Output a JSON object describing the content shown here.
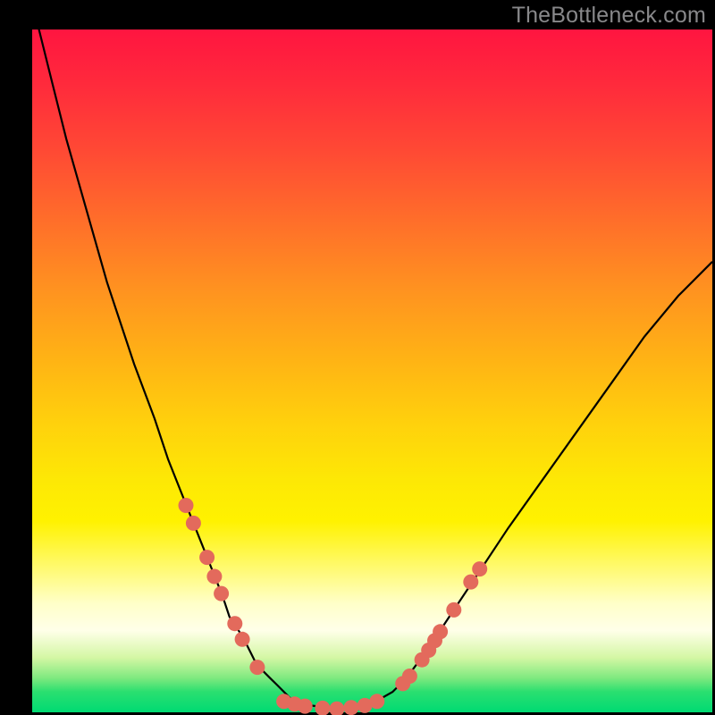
{
  "watermark": "TheBottleneck.com",
  "colors": {
    "frame": "#000000",
    "curve": "#000000",
    "dot": "#e36a5c",
    "gradient_top": "#ff1540",
    "gradient_bottom": "#00da73"
  },
  "chart_data": {
    "type": "line",
    "title": "",
    "xlabel": "",
    "ylabel": "",
    "xlim": [
      0,
      100
    ],
    "ylim": [
      0,
      100
    ],
    "note": "Axes are unlabeled in the source image; x is an arbitrary parameter (0–100) and y reads as percentage-like bottleneck magnitude (0–100). Values estimated from pixel positions.",
    "series": [
      {
        "name": "curve",
        "x": [
          0,
          1,
          3,
          5,
          7,
          9,
          11,
          13,
          15,
          18,
          20,
          22,
          24,
          26,
          28,
          29,
          31,
          32,
          33,
          35,
          36,
          38,
          41,
          44,
          47,
          50,
          53,
          55,
          58,
          62,
          66,
          70,
          75,
          80,
          85,
          90,
          95,
          100
        ],
        "y": [
          104,
          100,
          92,
          84,
          77,
          70,
          63,
          57,
          51,
          43,
          37,
          32,
          27,
          22,
          17,
          14,
          11,
          9,
          7,
          5,
          4,
          2,
          1,
          0.6,
          0.6,
          1.3,
          3,
          5,
          9,
          15,
          21,
          27,
          34,
          41,
          48,
          55,
          61,
          66
        ]
      }
    ],
    "markers": {
      "name": "dots",
      "note": "Salmon colored dots placed on the curve near the valley.",
      "points": [
        {
          "x": 22.6,
          "y": 30.3
        },
        {
          "x": 23.7,
          "y": 27.7
        },
        {
          "x": 25.7,
          "y": 22.7
        },
        {
          "x": 26.8,
          "y": 19.9
        },
        {
          "x": 27.8,
          "y": 17.4
        },
        {
          "x": 29.8,
          "y": 13.0
        },
        {
          "x": 30.9,
          "y": 10.7
        },
        {
          "x": 33.1,
          "y": 6.6
        },
        {
          "x": 37.0,
          "y": 1.6
        },
        {
          "x": 38.6,
          "y": 1.2
        },
        {
          "x": 40.1,
          "y": 0.9
        },
        {
          "x": 42.7,
          "y": 0.6
        },
        {
          "x": 44.8,
          "y": 0.5
        },
        {
          "x": 46.9,
          "y": 0.7
        },
        {
          "x": 48.9,
          "y": 1.0
        },
        {
          "x": 50.7,
          "y": 1.6
        },
        {
          "x": 54.5,
          "y": 4.2
        },
        {
          "x": 55.5,
          "y": 5.3
        },
        {
          "x": 57.3,
          "y": 7.7
        },
        {
          "x": 58.3,
          "y": 9.1
        },
        {
          "x": 59.2,
          "y": 10.5
        },
        {
          "x": 60.0,
          "y": 11.8
        },
        {
          "x": 62.0,
          "y": 15.0
        },
        {
          "x": 64.5,
          "y": 19.1
        },
        {
          "x": 65.8,
          "y": 21.0
        }
      ]
    }
  }
}
